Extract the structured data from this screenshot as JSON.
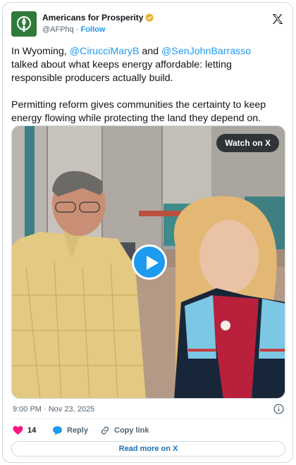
{
  "author": {
    "name": "Americans for Prosperity",
    "handle": "@AFPhq",
    "separator": "·",
    "follow_label": "Follow"
  },
  "tweet": {
    "p1_a": "In Wyoming, ",
    "mention1": "@CirucciMaryB",
    "p1_b": " and ",
    "mention2": "@SenJohnBarrasso",
    "p1_c": "\ntalked about what keeps energy affordable: letting\nresponsible producers actually build.\n\nPermitting reform gives communities the certainty to keep\nenergy flowing while protecting the land they depend on."
  },
  "video": {
    "watch_label": "Watch on X"
  },
  "timestamp": "9:00 PM · Nov 23, 2025",
  "actions": {
    "like_count": "14",
    "reply_label": "Reply",
    "copy_label": "Copy link"
  },
  "read_more_label": "Read more on X",
  "colors": {
    "accent": "#1d9bf0",
    "like": "#f91880",
    "brand_green": "#2f7a3b",
    "badge_gold": "#e8b12a"
  }
}
